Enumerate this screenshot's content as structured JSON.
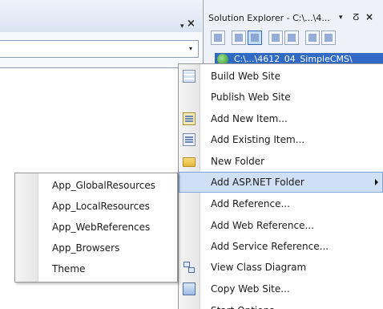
{
  "editor": {
    "close_glyph": "×",
    "dropdown_glyph": "▾",
    "combo_arrow_glyph": "▾"
  },
  "solution_explorer": {
    "title": "Solution Explorer - C:\\...\\4...",
    "title_dropdown_glyph": "▾",
    "pin_glyph": "ⵒ",
    "close_glyph": "×",
    "root_node": "C:\\...\\4612_04_SimpleCMS\\"
  },
  "context_menu": {
    "items": [
      {
        "label": "Build Web Site",
        "icon": "build-icon"
      },
      {
        "label": "Publish Web Site",
        "icon": ""
      },
      {
        "label": "Add New Item...",
        "icon": "add-new-item-icon"
      },
      {
        "label": "Add Existing Item...",
        "icon": "add-existing-item-icon"
      },
      {
        "label": "New Folder",
        "icon": "folder-icon"
      },
      {
        "label": "Add ASP.NET Folder",
        "icon": "",
        "has_submenu": true,
        "highlighted": true
      },
      {
        "label": "Add Reference...",
        "icon": ""
      },
      {
        "label": "Add Web Reference...",
        "icon": ""
      },
      {
        "label": "Add Service Reference...",
        "icon": ""
      },
      {
        "label": "View Class Diagram",
        "icon": "class-diagram-icon"
      },
      {
        "label": "Copy Web Site...",
        "icon": "copy-web-site-icon"
      },
      {
        "label": "Start Options...",
        "icon": ""
      }
    ]
  },
  "sub_menu": {
    "items": [
      {
        "label": "App_GlobalResources"
      },
      {
        "label": "App_LocalResources"
      },
      {
        "label": "App_WebReferences"
      },
      {
        "label": "App_Browsers"
      },
      {
        "label": "Theme"
      }
    ]
  },
  "colors": {
    "highlight": "#c2d7f1",
    "selection": "#316ac5"
  }
}
